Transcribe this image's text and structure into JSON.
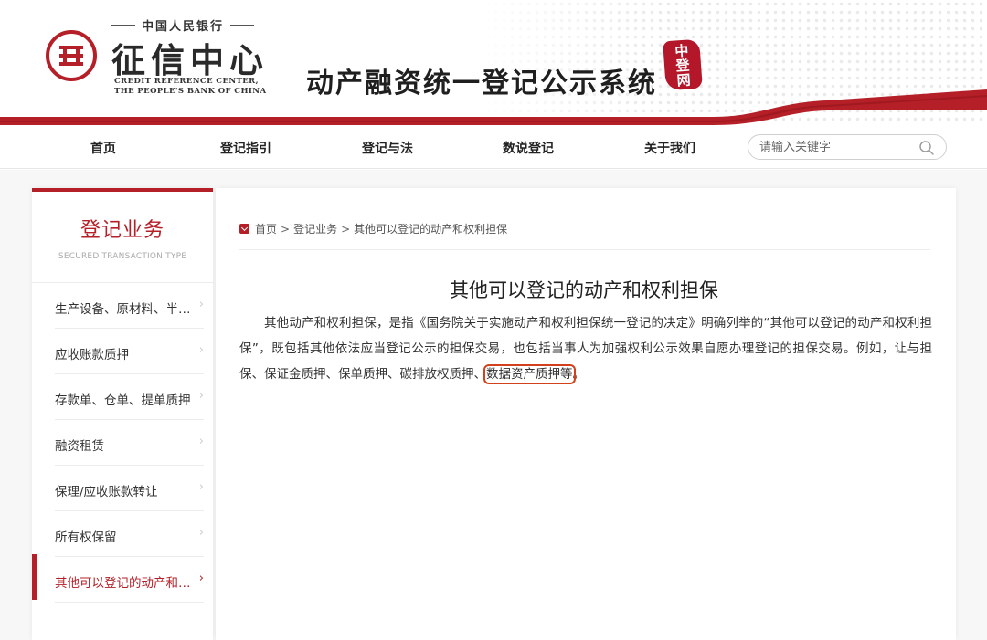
{
  "header": {
    "bank_name": "中国人民银行",
    "org_title": "征信中心",
    "org_en_line1": "CREDIT REFERENCE CENTER,",
    "org_en_line2": "THE PEOPLE'S BANK OF CHINA",
    "system_title": "动产融资统一登记公示系统",
    "seal_text": "中登网"
  },
  "nav": {
    "items": [
      "首页",
      "登记指引",
      "登记与法",
      "数说登记",
      "关于我们"
    ],
    "search_placeholder": "请输入关键字"
  },
  "sidebar": {
    "title": "登记业务",
    "subtitle": "SECURED TRANSACTION TYPE",
    "items": [
      {
        "label": "生产设备、原材料、半成品、产品抵押"
      },
      {
        "label": "应收账款质押"
      },
      {
        "label": "存款单、仓单、提单质押"
      },
      {
        "label": "融资租赁"
      },
      {
        "label": "保理/应收账款转让"
      },
      {
        "label": "所有权保留"
      },
      {
        "label": "其他可以登记的动产和权利担保",
        "active": true
      }
    ]
  },
  "breadcrumb": {
    "items": [
      "首页",
      "登记业务",
      "其他可以登记的动产和权利担保"
    ],
    "separator": ">"
  },
  "article": {
    "title": "其他可以登记的动产和权利担保",
    "body_main": "其他动产和权利担保，是指《国务院关于实施动产和权利担保统一登记的决定》明确列举的“其他可以登记的动产和权利担保”，既包括其他依法应当登记公示的担保交易，也包括当事人为加强权利公示效果自愿办理登记的担保交易。例如，让与担保、保证金质押、保单质押、碳排放权质押、",
    "body_highlight": "数据资产质押等",
    "body_end": "。"
  },
  "colors": {
    "brand_red": "#b51f27",
    "highlight_box": "#d2401c"
  }
}
